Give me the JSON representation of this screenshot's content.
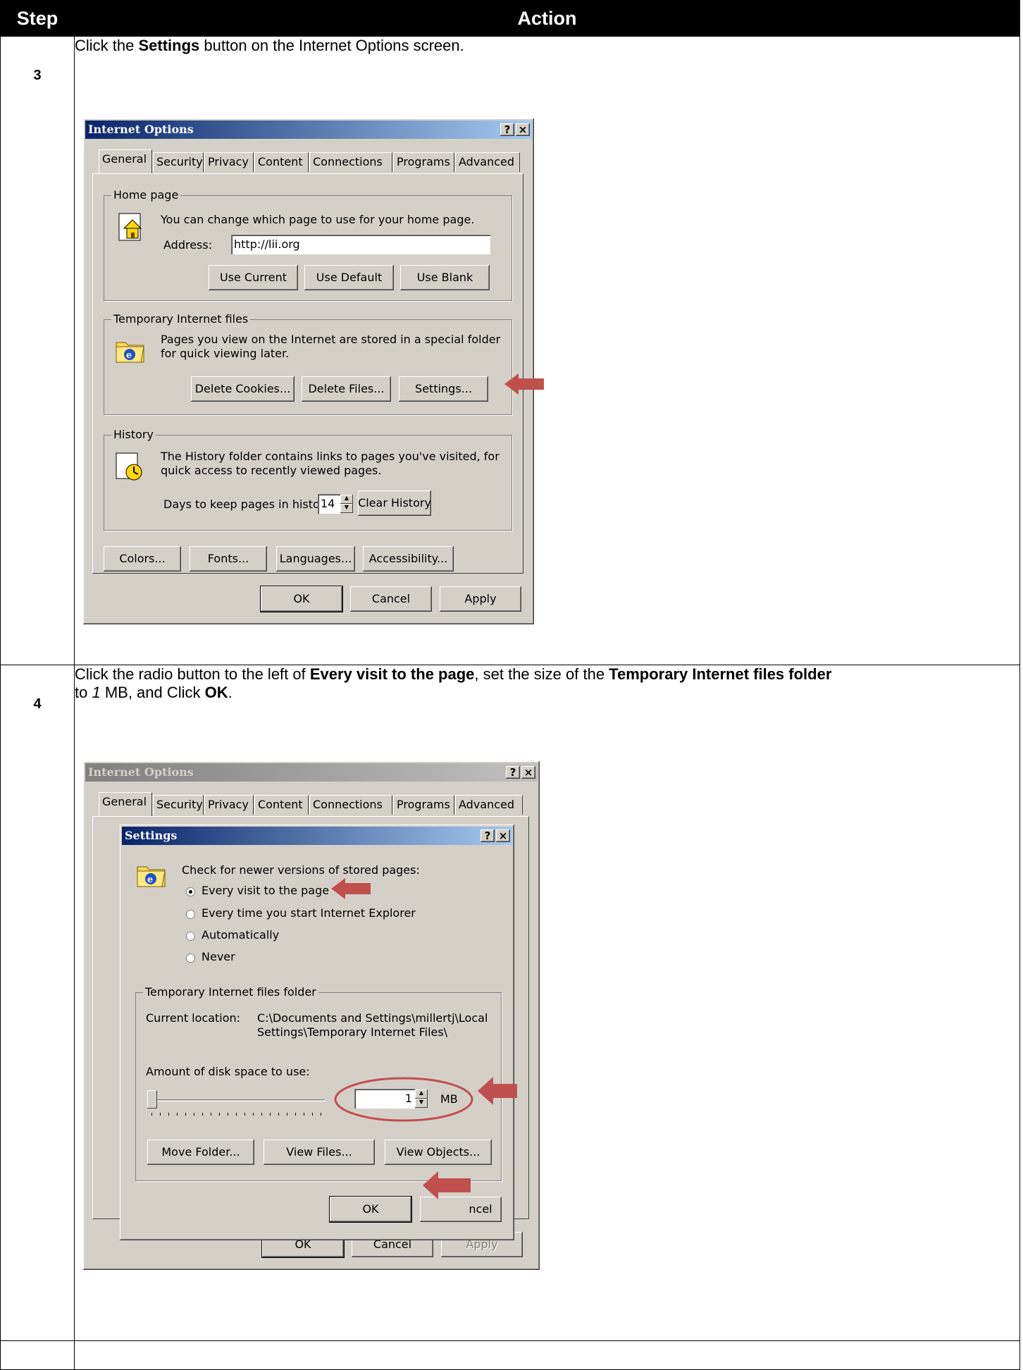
{
  "header": {
    "step_label": "Step",
    "action_label": "Action"
  },
  "step3": {
    "number": "3",
    "instr_pre": "Click the ",
    "instr_bold": "Settings",
    "instr_post": " button on the Internet Options screen.",
    "dialog": {
      "title": "Internet Options",
      "help_btn": "?",
      "close_btn": "×",
      "tabs": [
        "General",
        "Security",
        "Privacy",
        "Content",
        "Connections",
        "Programs",
        "Advanced"
      ],
      "home_group": "Home page",
      "home_desc": "You can change which page to use for your home page.",
      "address_label": "Address:",
      "address_value": "http://lii.org",
      "use_current": "Use Current",
      "use_default": "Use Default",
      "use_blank": "Use Blank",
      "temp_group": "Temporary Internet files",
      "temp_desc1": "Pages you view on the Internet are stored in a special folder",
      "temp_desc2": "for quick viewing later.",
      "delete_cookies": "Delete Cookies...",
      "delete_files": "Delete Files...",
      "settings": "Settings...",
      "history_group": "History",
      "history_desc1": "The History folder contains links to pages you've visited, for",
      "history_desc2": "quick access to recently viewed pages.",
      "days_label": "Days to keep pages in history:",
      "days_value": "14",
      "clear_history": "Clear History",
      "colors": "Colors...",
      "fonts": "Fonts...",
      "languages": "Languages...",
      "accessibility": "Accessibility...",
      "ok": "OK",
      "cancel": "Cancel",
      "apply": "Apply"
    }
  },
  "step4": {
    "number": "4",
    "instr_a": "Click the radio button to the left of ",
    "instr_b": "Every visit to the page",
    "instr_c": ", set the size of the ",
    "instr_d": "Temporary Internet files folder",
    "instr_e": "to ",
    "instr_f": "1",
    "instr_g": " MB, and Click ",
    "instr_h": "OK",
    "instr_i": ".",
    "dialog": {
      "title": "Internet Options",
      "tabs": [
        "General",
        "Security",
        "Privacy",
        "Content",
        "Connections",
        "Programs",
        "Advanced"
      ],
      "ok": "OK",
      "cancel": "Cancel",
      "apply": "Apply",
      "settings": {
        "title": "Settings",
        "check_label": "Check for newer versions of stored pages:",
        "options": [
          "Every visit to the page",
          "Every time you start Internet Explorer",
          "Automatically",
          "Never"
        ],
        "selected_index": 0,
        "folder_group": "Temporary Internet files folder",
        "location_label": "Current location:",
        "location_1": "C:\\Documents and Settings\\millertj\\Local",
        "location_2": "Settings\\Temporary Internet Files\\",
        "disk_label": "Amount of disk space to use:",
        "disk_value": "1",
        "disk_unit": "MB",
        "move_folder": "Move Folder...",
        "view_files": "View Files...",
        "view_objects": "View Objects...",
        "ok": "OK",
        "cancel_fragment": "ncel"
      }
    }
  },
  "colors": {
    "arrow": "#c0504d",
    "titlebar": "#0a246a",
    "dialog_face": "#d4d0c8"
  }
}
